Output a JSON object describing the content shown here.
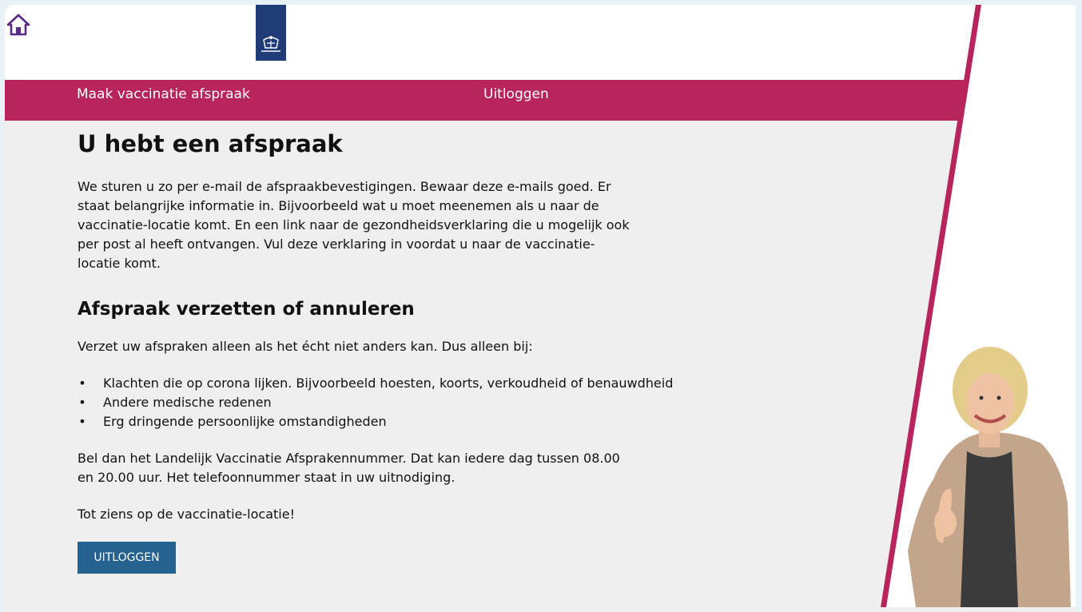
{
  "header": {
    "home_icon": "home-icon",
    "logo": "rijksoverheid-logo"
  },
  "nav": {
    "afspraak_label": "Maak vaccinatie afspraak",
    "uitloggen_label": "Uitloggen"
  },
  "main": {
    "title": "U hebt een afspraak",
    "intro": "We sturen u zo per e-mail de afspraakbevestigingen. Bewaar deze e-mails goed. Er staat belangrijke informatie in. Bijvoorbeeld wat u moet meenemen als u naar de vaccinatie-locatie komt. En een link naar de gezondheidsverklaring die u mogelijk ook per post al heeft ontvangen. Vul deze verklaring in voordat u naar de vaccinatie-locatie komt.",
    "subtitle": "Afspraak verzetten of annuleren",
    "verzet_text": "Verzet uw afspraken alleen als het écht niet anders kan. Dus alleen bij:",
    "reasons": [
      "Klachten die op corona lijken. Bijvoorbeeld hoesten, koorts, verkoudheid of benauwdheid",
      "Andere medische redenen",
      "Erg dringende persoonlijke omstandigheden"
    ],
    "bel_text": "Bel dan het Landelijk Vaccinatie Afsprakennummer. Dat kan iedere dag tussen 08.00 en 20.00 uur. Het telefoonnummer staat in uw uitnodiging.",
    "tot_ziens": "Tot ziens op de vaccinatie-locatie!",
    "logout_button": "UITLOGGEN"
  },
  "colors": {
    "brand": "#b8255c",
    "button": "#26628f",
    "logo": "#1f3c78",
    "home_icon": "#5b2a86"
  }
}
